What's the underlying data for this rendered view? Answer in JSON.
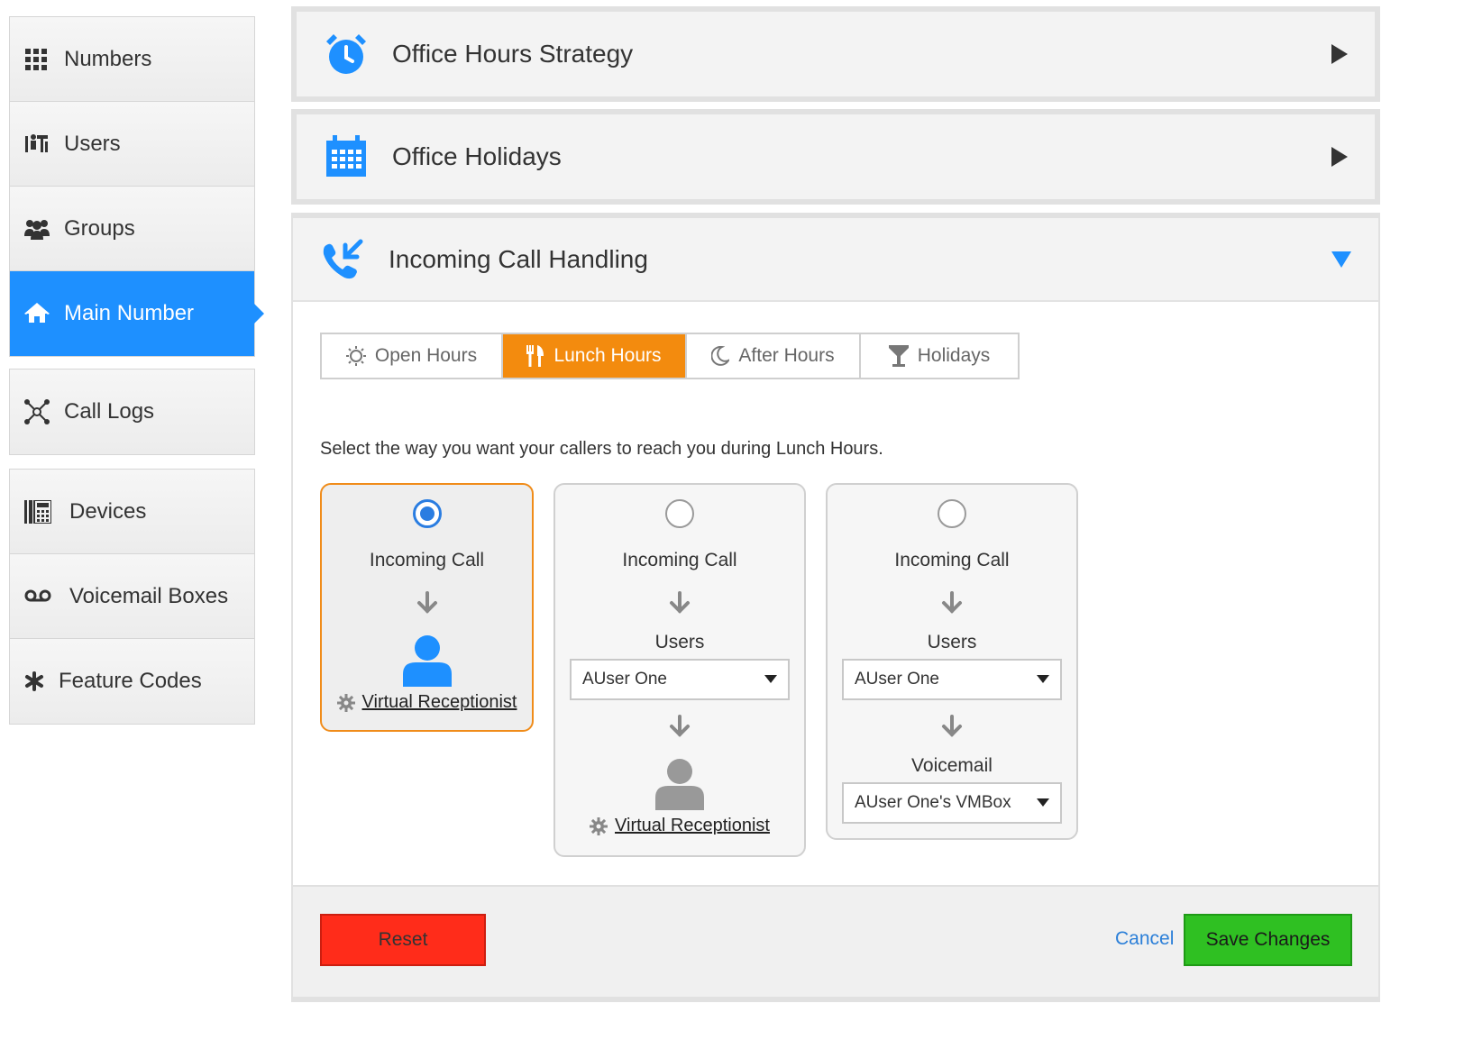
{
  "sidebar": {
    "items": [
      {
        "label": "Numbers",
        "icon": "grid-icon",
        "active": false
      },
      {
        "label": "Users",
        "icon": "users-icon",
        "active": false
      },
      {
        "label": "Groups",
        "icon": "group-icon",
        "active": false
      },
      {
        "label": "Main Number",
        "icon": "home-icon",
        "active": true
      },
      {
        "label": "Call Logs",
        "icon": "network-icon",
        "active": false
      },
      {
        "label": "Devices",
        "icon": "phone-device-icon",
        "active": false
      },
      {
        "label": "Voicemail Boxes",
        "icon": "voicemail-icon",
        "active": false
      },
      {
        "label": "Feature Codes",
        "icon": "asterisk-icon",
        "active": false
      }
    ]
  },
  "panels": {
    "office_hours": {
      "title": "Office Hours Strategy",
      "icon": "alarm-clock-icon",
      "expanded": false
    },
    "office_holidays": {
      "title": "Office Holidays",
      "icon": "calendar-icon",
      "expanded": false
    },
    "incoming": {
      "title": "Incoming Call Handling",
      "icon": "incoming-call-icon",
      "expanded": true
    }
  },
  "tabs": [
    {
      "label": "Open Hours",
      "icon": "sun-icon",
      "active": false
    },
    {
      "label": "Lunch Hours",
      "icon": "utensils-icon",
      "active": true
    },
    {
      "label": "After Hours",
      "icon": "moon-icon",
      "active": false
    },
    {
      "label": "Holidays",
      "icon": "cocktail-icon",
      "active": false
    }
  ],
  "instruction": "Select the way you want your callers to reach you during Lunch Hours.",
  "options": [
    {
      "selected": true,
      "incoming_label": "Incoming Call",
      "receptionist_label": "Virtual Receptionist"
    },
    {
      "selected": false,
      "incoming_label": "Incoming Call",
      "users_label": "Users",
      "users_value": "AUser One",
      "receptionist_label": "Virtual Receptionist"
    },
    {
      "selected": false,
      "incoming_label": "Incoming Call",
      "users_label": "Users",
      "users_value": "AUser One",
      "voicemail_label": "Voicemail",
      "voicemail_value": "AUser One's VMBox"
    }
  ],
  "footer": {
    "reset_label": "Reset",
    "cancel_label": "Cancel",
    "save_label": "Save Changes"
  },
  "colors": {
    "accent_blue": "#1e90ff",
    "tab_active_orange": "#f38b0e",
    "radio_blue": "#2a7de1",
    "reset_red": "#ff2c1a",
    "save_green": "#2fc022"
  }
}
